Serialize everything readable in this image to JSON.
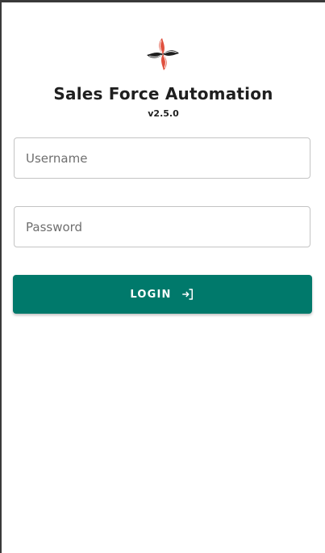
{
  "app": {
    "logo_icon": "pinwheel-logo-icon",
    "title": "Sales Force Automation",
    "version": "v2.5.0"
  },
  "form": {
    "username": {
      "placeholder": "Username",
      "value": ""
    },
    "password": {
      "placeholder": "Password",
      "value": ""
    },
    "login_button": {
      "label": "LOGIN",
      "icon": "login-icon"
    }
  },
  "colors": {
    "primary": "#00796b",
    "logo_red": "#e0513f",
    "logo_dark": "#1f1f1f"
  }
}
